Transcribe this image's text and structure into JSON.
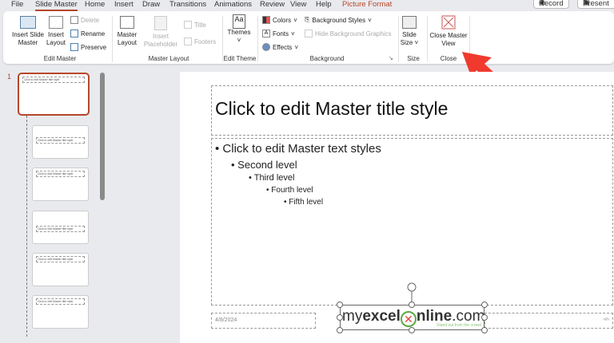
{
  "menu": {
    "tabs": [
      "File",
      "Slide Master",
      "Home",
      "Insert",
      "Draw",
      "Transitions",
      "Animations",
      "Review",
      "View",
      "Help",
      "Picture Format"
    ],
    "active": "Slide Master",
    "record": "Record",
    "present": "Present"
  },
  "ribbon": {
    "edit_master": {
      "insert_slide_master": "Insert Slide Master",
      "insert_layout": "Insert Layout",
      "delete": "Delete",
      "rename": "Rename",
      "preserve": "Preserve",
      "label": "Edit Master"
    },
    "master_layout": {
      "master_layout": "Master Layout",
      "insert_placeholder": "Insert Placeholder",
      "title": "Title",
      "footers": "Footers",
      "label": "Master Layout"
    },
    "edit_theme": {
      "themes": "Themes",
      "label": "Edit Theme"
    },
    "background": {
      "colors": "Colors",
      "fonts": "Fonts",
      "effects": "Effects",
      "background_styles": "Background Styles",
      "hide_background_graphics": "Hide Background Graphics",
      "label": "Background"
    },
    "size": {
      "slide_size": "Slide Size",
      "label": "Size"
    },
    "close": {
      "close_master_view": "Close Master View",
      "label": "Close"
    }
  },
  "thumbnails": {
    "number": "1",
    "master_title": "Click to edit Master title style"
  },
  "slide": {
    "title": "Click to edit Master title style",
    "levels": [
      "Click to edit Master text styles",
      "Second level",
      "Third level",
      "Fourth level",
      "Fifth level"
    ],
    "date": "4/8/2024",
    "slide_number": "‹#›",
    "logo": {
      "my": "my",
      "excel": "excel",
      "nline": "nline",
      "com": ".com",
      "tagline": "Stand out from the crowd"
    }
  },
  "colors": {
    "accent": "#b7472a",
    "arrow": "#f03a2e"
  }
}
